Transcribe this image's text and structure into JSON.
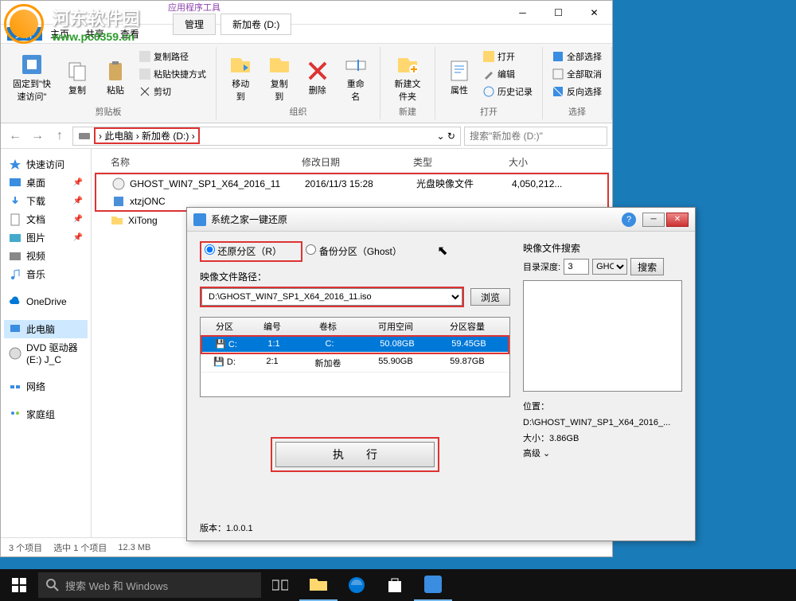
{
  "watermark": {
    "text": "河东软件园",
    "url": "www.pc0359.cn"
  },
  "explorer": {
    "title_tabs": {
      "tools_group": "应用程序工具",
      "manage": "管理",
      "drive": "新加卷 (D:)"
    },
    "menu": {
      "file": "文件",
      "home": "主页",
      "share": "共享",
      "view": "查看"
    },
    "ribbon": {
      "pin": "固定到\"快速访问\"",
      "copy": "复制",
      "paste": "粘贴",
      "copy_path": "复制路径",
      "paste_shortcut": "粘贴快捷方式",
      "cut": "剪切",
      "clipboard_group": "剪贴板",
      "move_to": "移动到",
      "copy_to": "复制到",
      "delete": "删除",
      "rename": "重命名",
      "organize_group": "组织",
      "new_folder": "新建文件夹",
      "new_group": "新建",
      "properties": "属性",
      "open": "打开",
      "edit": "编辑",
      "history": "历史记录",
      "open_group": "打开",
      "select_all": "全部选择",
      "select_none": "全部取消",
      "invert_select": "反向选择",
      "select_group": "选择"
    },
    "breadcrumb": {
      "this_pc": "此电脑",
      "drive": "新加卷 (D:)"
    },
    "search_placeholder": "搜索\"新加卷 (D:)\"",
    "sidebar": {
      "quick_access": "快速访问",
      "desktop": "桌面",
      "downloads": "下载",
      "documents": "文档",
      "pictures": "图片",
      "videos": "视频",
      "music": "音乐",
      "onedrive": "OneDrive",
      "this_pc": "此电脑",
      "dvd": "DVD 驱动器 (E:) J_C",
      "network": "网络",
      "homegroup": "家庭组"
    },
    "columns": {
      "name": "名称",
      "date": "修改日期",
      "type": "类型",
      "size": "大小"
    },
    "files": [
      {
        "name": "GHOST_WIN7_SP1_X64_2016_11",
        "date": "2016/11/3 15:28",
        "type": "光盘映像文件",
        "size": "4,050,212..."
      },
      {
        "name": "xtzjONC",
        "date": "",
        "type": "",
        "size": ""
      },
      {
        "name": "XiTong",
        "date": "",
        "type": "",
        "size": ""
      }
    ],
    "status": {
      "items": "3 个项目",
      "selected": "选中 1 个项目",
      "size": "12.3 MB"
    }
  },
  "ghost": {
    "title": "系统之家一键还原",
    "restore_radio": "还原分区（R）",
    "backup_radio": "备份分区（Ghost）",
    "path_label": "映像文件路径：",
    "path_value": "D:\\GHOST_WIN7_SP1_X64_2016_11.iso",
    "browse": "浏览",
    "table_headers": {
      "partition": "分区",
      "number": "编号",
      "label": "卷标",
      "free": "可用空间",
      "capacity": "分区容量"
    },
    "partitions": [
      {
        "partition": "C:",
        "number": "1:1",
        "label": "C:",
        "free": "50.08GB",
        "capacity": "59.45GB",
        "selected": true
      },
      {
        "partition": "D:",
        "number": "2:1",
        "label": "新加卷",
        "free": "55.90GB",
        "capacity": "59.87GB",
        "selected": false
      }
    ],
    "execute": "执　　行",
    "search_title": "映像文件搜索",
    "depth_label": "目录深度:",
    "depth_value": "3",
    "ext": "GHO",
    "search_btn": "搜索",
    "location_label": "位置：",
    "location_value": "D:\\GHOST_WIN7_SP1_X64_2016_...",
    "size_label": "大小：",
    "size_value": "3.86GB",
    "advanced": "高级",
    "version_label": "版本：",
    "version_value": "1.0.0.1"
  },
  "taskbar": {
    "search_placeholder": "搜索 Web 和 Windows"
  }
}
